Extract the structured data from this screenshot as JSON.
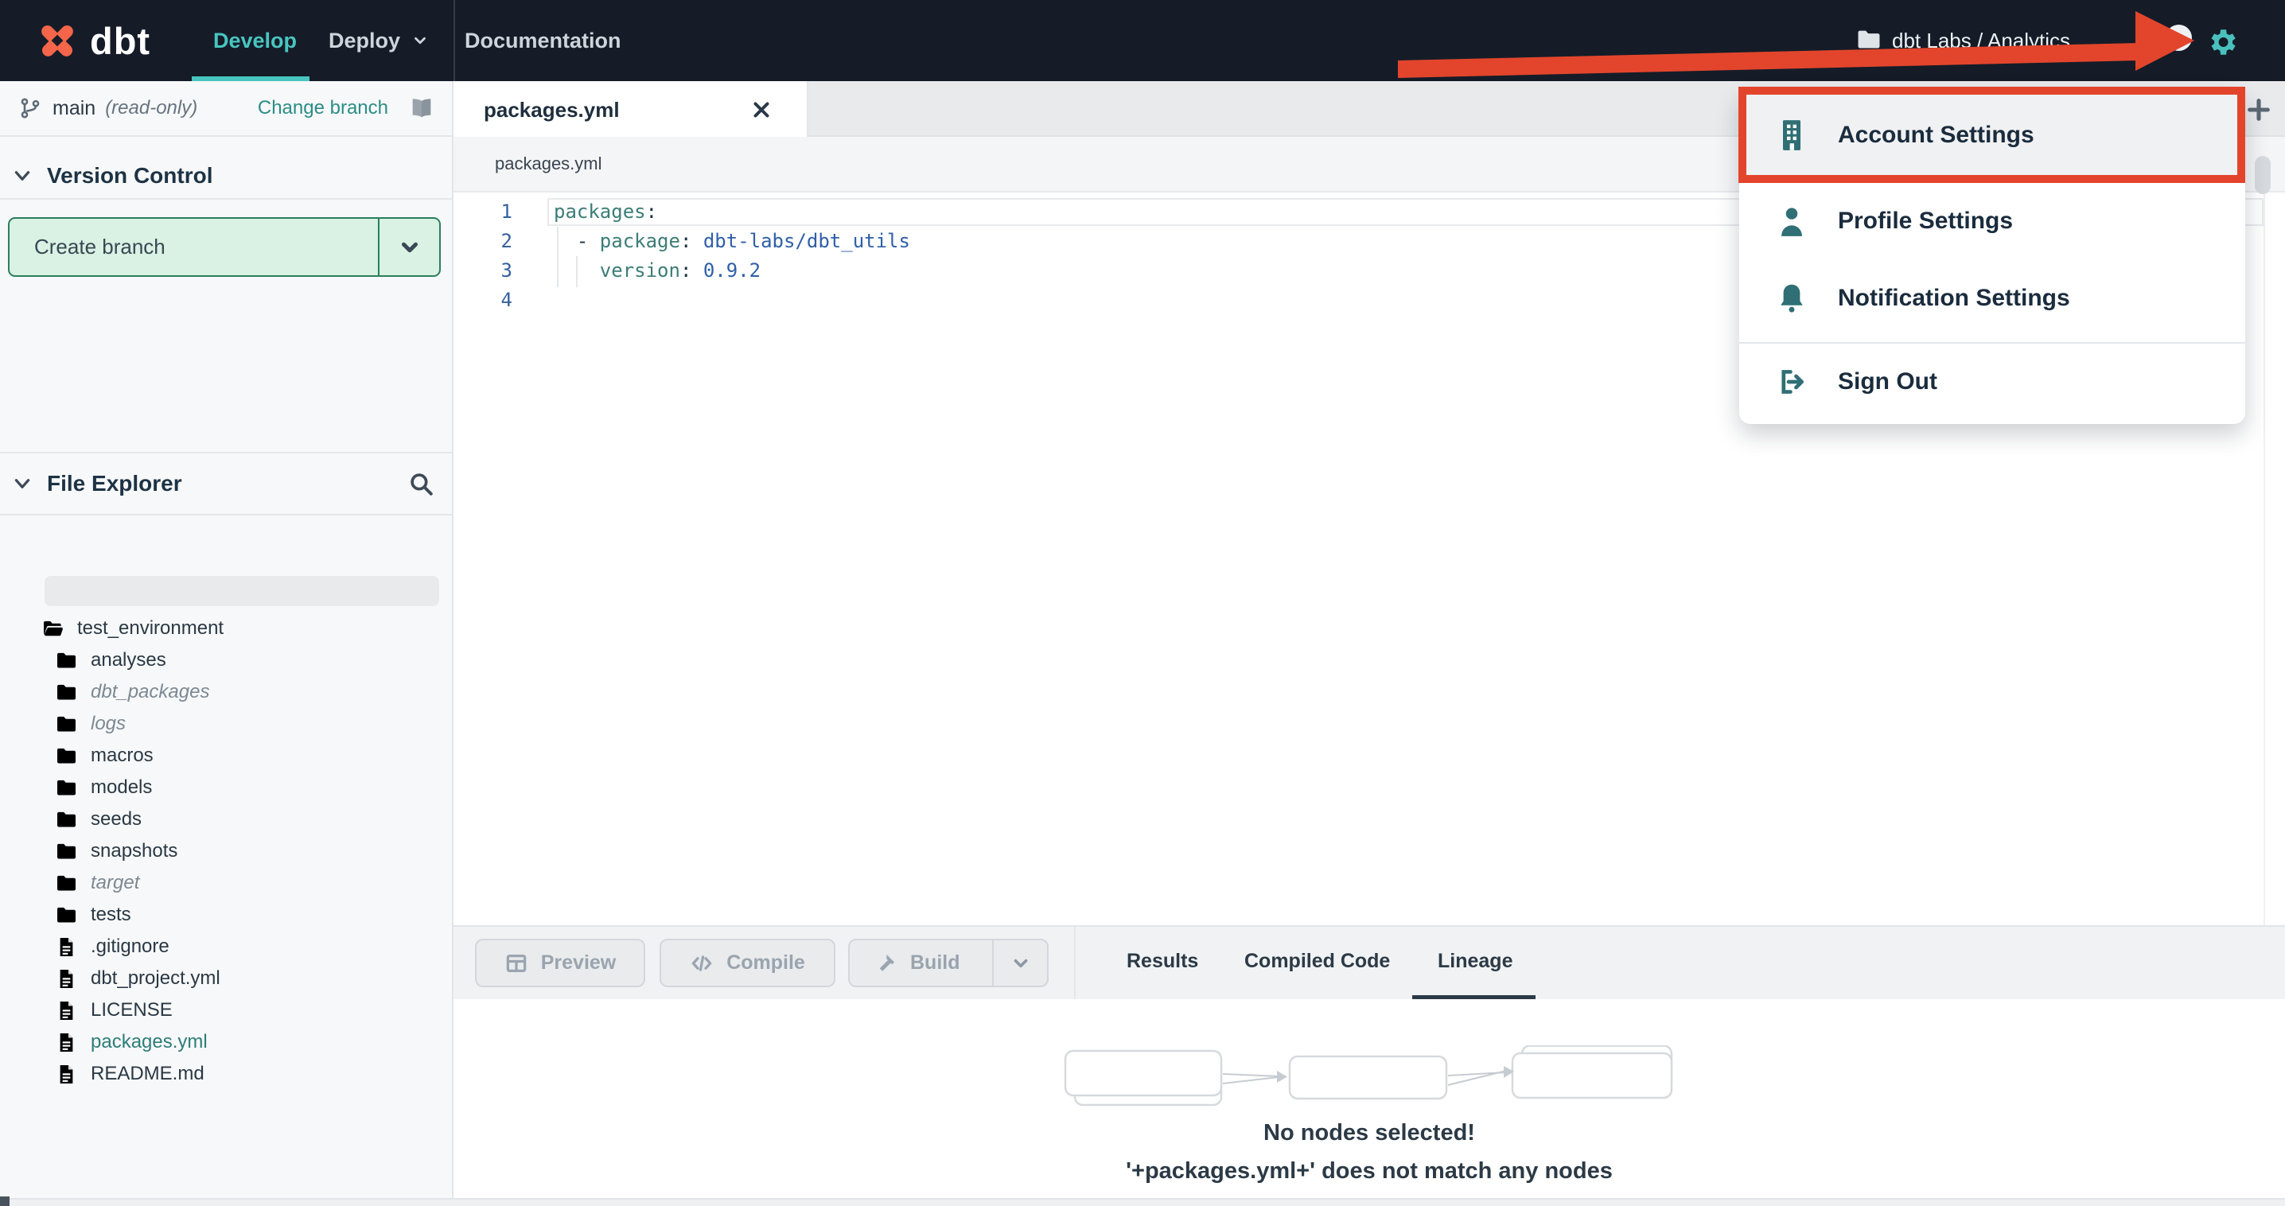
{
  "colors": {
    "navbar_bg": "#151c28",
    "accent_teal": "#49c5c0",
    "annotation_red": "#e2452c",
    "brand_orange": "#f4654a",
    "menu_icon_teal": "#2f6f75",
    "link_teal": "#2b8d86",
    "create_branch_border_green": "#2c7e5d",
    "create_branch_bg": "#d9f2e3",
    "code_key_teal": "#3c7d76",
    "code_value_blue": "#2f5fa8"
  },
  "navbar": {
    "brand": "dbt",
    "items": [
      {
        "label": "Develop",
        "active": true
      },
      {
        "label": "Deploy",
        "active": false
      },
      {
        "label": "Documentation",
        "active": false
      }
    ],
    "project": "dbt Labs / Analytics"
  },
  "account_menu": {
    "items": [
      {
        "label": "Account Settings",
        "icon": "building-icon",
        "highlighted": true
      },
      {
        "label": "Profile Settings",
        "icon": "user-icon",
        "highlighted": false
      },
      {
        "label": "Notification Settings",
        "icon": "bell-icon",
        "highlighted": false
      },
      {
        "label": "Sign Out",
        "icon": "sign-out-icon",
        "highlighted": false
      }
    ]
  },
  "version_control": {
    "branch": "main",
    "branch_mode": "(read-only)",
    "change_branch": "Change branch",
    "section_title": "Version Control",
    "create_branch": "Create branch"
  },
  "file_explorer": {
    "section_title": "File Explorer",
    "items": [
      {
        "name": "test_environment",
        "type": "folder-open",
        "italic": false,
        "selected": false,
        "level": 0
      },
      {
        "name": "analyses",
        "type": "folder",
        "italic": false,
        "selected": false,
        "level": 1
      },
      {
        "name": "dbt_packages",
        "type": "folder",
        "italic": true,
        "selected": false,
        "level": 1
      },
      {
        "name": "logs",
        "type": "folder",
        "italic": true,
        "selected": false,
        "level": 1
      },
      {
        "name": "macros",
        "type": "folder",
        "italic": false,
        "selected": false,
        "level": 1
      },
      {
        "name": "models",
        "type": "folder",
        "italic": false,
        "selected": false,
        "level": 1
      },
      {
        "name": "seeds",
        "type": "folder",
        "italic": false,
        "selected": false,
        "level": 1
      },
      {
        "name": "snapshots",
        "type": "folder",
        "italic": false,
        "selected": false,
        "level": 1
      },
      {
        "name": "target",
        "type": "folder",
        "italic": true,
        "selected": false,
        "level": 1
      },
      {
        "name": "tests",
        "type": "folder",
        "italic": false,
        "selected": false,
        "level": 1
      },
      {
        "name": ".gitignore",
        "type": "file",
        "italic": false,
        "selected": false,
        "level": 1
      },
      {
        "name": "dbt_project.yml",
        "type": "file",
        "italic": false,
        "selected": false,
        "level": 1
      },
      {
        "name": "LICENSE",
        "type": "file",
        "italic": false,
        "selected": false,
        "level": 1
      },
      {
        "name": "packages.yml",
        "type": "file",
        "italic": false,
        "selected": true,
        "level": 1
      },
      {
        "name": "README.md",
        "type": "file",
        "italic": false,
        "selected": false,
        "level": 1
      }
    ]
  },
  "editor": {
    "tab": "packages.yml",
    "breadcrumb": "packages.yml",
    "lines": [
      {
        "num": "1",
        "tokens": [
          {
            "c": "key",
            "t": "packages"
          },
          {
            "c": "pun",
            "t": ":"
          }
        ]
      },
      {
        "num": "2",
        "tokens": [
          {
            "c": "pun",
            "t": "  - "
          },
          {
            "c": "key",
            "t": "package"
          },
          {
            "c": "pun",
            "t": ": "
          },
          {
            "c": "val",
            "t": "dbt-labs/dbt_utils"
          }
        ]
      },
      {
        "num": "3",
        "tokens": [
          {
            "c": "pun",
            "t": "    "
          },
          {
            "c": "key",
            "t": "version"
          },
          {
            "c": "pun",
            "t": ": "
          },
          {
            "c": "val",
            "t": "0.9.2"
          }
        ]
      },
      {
        "num": "4",
        "tokens": []
      }
    ]
  },
  "action_bar": {
    "buttons": [
      {
        "label": "Preview",
        "icon": "table-icon",
        "enabled": false
      },
      {
        "label": "Compile",
        "icon": "code-icon",
        "enabled": false
      },
      {
        "label": "Build",
        "icon": "hammer-icon",
        "enabled": false,
        "split": true
      }
    ],
    "tabs": [
      {
        "label": "Results",
        "active": false
      },
      {
        "label": "Compiled Code",
        "active": false
      },
      {
        "label": "Lineage",
        "active": true
      }
    ]
  },
  "lineage": {
    "empty_title": "No nodes selected!",
    "empty_subtitle": "'+packages.yml+' does not match any nodes"
  }
}
